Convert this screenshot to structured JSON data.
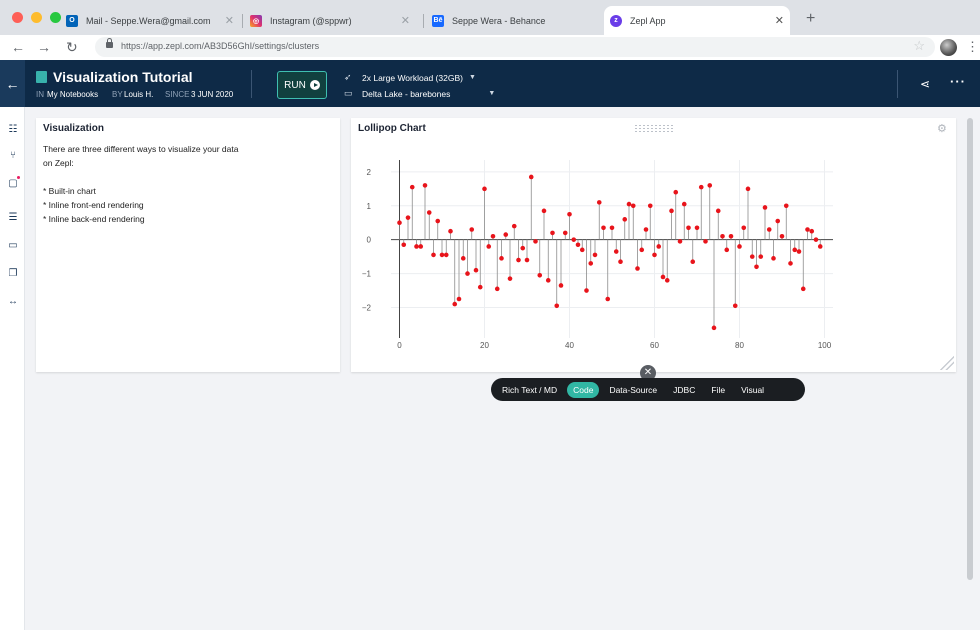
{
  "browser": {
    "tabs": [
      {
        "label": "Mail - Seppe.Wera@gmail.com",
        "icon": "outlook-icon",
        "color": "#0364b8"
      },
      {
        "label": "Instagram (@sppwr)",
        "icon": "instagram-icon",
        "color": "#e1306c"
      },
      {
        "label": "Seppe Wera - Behance",
        "icon": "behance-icon",
        "color": "#1769ff",
        "glyph": "Bē"
      },
      {
        "label": "Zepl App",
        "icon": "zepl-icon",
        "color": "#6a3de8"
      }
    ],
    "url": "https://app.zepl.com/AB3D56GhI/settings/clusters"
  },
  "header": {
    "title": "Visualization Tutorial",
    "in_label": "IN",
    "in_value": "My Notebooks",
    "by_label": "BY",
    "by_value": "Louis H.",
    "since_label": "SINCE",
    "since_value": "3 JUN 2020",
    "run_label": "RUN",
    "workload": "2x Large Workload (32GB)",
    "datasource": "Delta Lake - barebones"
  },
  "text_panel": {
    "title": "Visualization",
    "body": "There are three different ways to visualize your data\non Zepl:\n\n* Built-in chart\n* Inline front-end rendering\n* Inline back-end rendering"
  },
  "chart_panel": {
    "title": "Lollipop Chart"
  },
  "toolbar": {
    "items": [
      "Rich Text / MD",
      "Code",
      "Data-Source",
      "JDBC",
      "File",
      "Visual"
    ],
    "active": "Code"
  },
  "colors": {
    "header_bg": "#0e2a47",
    "accent": "#31b7a4",
    "marker": "#e8141b"
  },
  "chart_data": {
    "type": "scatter",
    "title": "Lollipop Chart",
    "marker": "lollipop",
    "xlim": [
      -2,
      102
    ],
    "ylim": [
      -2.9,
      2.35
    ],
    "xticks": [
      0,
      20,
      40,
      60,
      80,
      100
    ],
    "yticks": [
      -2,
      -1,
      0,
      1,
      2
    ],
    "grid": true,
    "x": [
      0,
      1,
      2,
      3,
      4,
      5,
      6,
      7,
      8,
      9,
      10,
      11,
      12,
      13,
      14,
      15,
      16,
      17,
      18,
      19,
      20,
      21,
      22,
      23,
      24,
      25,
      26,
      27,
      28,
      29,
      30,
      31,
      32,
      33,
      34,
      35,
      36,
      37,
      38,
      39,
      40,
      41,
      42,
      43,
      44,
      45,
      46,
      47,
      48,
      49,
      50,
      51,
      52,
      53,
      54,
      55,
      56,
      57,
      58,
      59,
      60,
      61,
      62,
      63,
      64,
      65,
      66,
      67,
      68,
      69,
      70,
      71,
      72,
      73,
      74,
      75,
      76,
      77,
      78,
      79,
      80,
      81,
      82,
      83,
      84,
      85,
      86,
      87,
      88,
      89,
      90,
      91,
      92,
      93,
      94,
      95,
      96,
      97,
      98,
      99
    ],
    "y": [
      0.5,
      -0.15,
      0.65,
      1.55,
      -0.2,
      -0.2,
      1.6,
      0.8,
      -0.45,
      0.55,
      -0.45,
      -0.45,
      0.25,
      -1.9,
      -1.75,
      -0.55,
      -1.0,
      0.3,
      -0.9,
      -1.4,
      1.5,
      -0.2,
      0.1,
      -1.45,
      -0.55,
      0.15,
      -1.15,
      0.4,
      -0.6,
      -0.25,
      -0.6,
      1.85,
      -0.05,
      -1.05,
      0.85,
      -1.2,
      0.2,
      -1.95,
      -1.35,
      0.2,
      0.75,
      0.0,
      -0.15,
      -0.3,
      -1.5,
      -0.7,
      -0.45,
      1.1,
      0.35,
      -1.75,
      0.35,
      -0.35,
      -0.65,
      0.6,
      1.05,
      1.0,
      -0.85,
      -0.3,
      0.3,
      1.0,
      -0.45,
      -0.2,
      -1.1,
      -1.2,
      0.85,
      1.4,
      -0.05,
      1.05,
      0.35,
      -0.65,
      0.35,
      1.55,
      -0.05,
      1.6,
      -2.6,
      0.85,
      0.1,
      -0.3,
      0.1,
      -1.95,
      -0.2,
      0.35,
      1.5,
      -0.5,
      -0.8,
      -0.5,
      0.95,
      0.3,
      -0.55,
      0.55,
      0.1,
      1.0,
      -0.7,
      -0.3,
      -0.35,
      -1.45,
      0.3,
      0.25,
      0.0,
      -0.2
    ]
  }
}
